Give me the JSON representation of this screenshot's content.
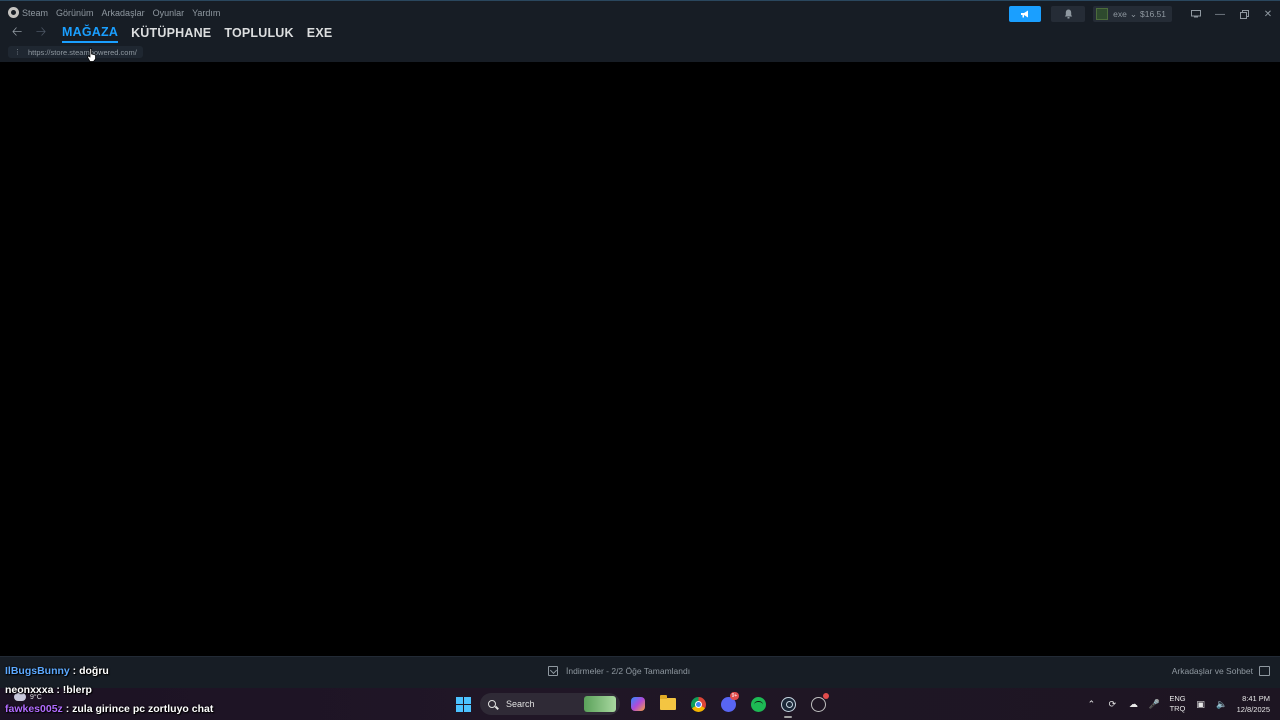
{
  "menu": {
    "steam": "Steam",
    "view": "Görünüm",
    "friends": "Arkadaşlar",
    "games": "Oyunlar",
    "help": "Yardım"
  },
  "tabs": [
    {
      "label": "MAĞAZA",
      "active": true
    },
    {
      "label": "KÜTÜPHANE",
      "active": false
    },
    {
      "label": "TOPLULUK",
      "active": false
    },
    {
      "label": "EXE",
      "active": false
    }
  ],
  "url": "https://store.steampowered.com/",
  "account": {
    "name": "exe",
    "balance": "$16.51"
  },
  "status": {
    "downloads": "İndirmeler - 2/2 Öğe Tamamlandı",
    "friends_chat": "Arkadaşlar ve Sohbet"
  },
  "taskbar": {
    "search_label": "Search",
    "discord_badge": "9+",
    "lang_top": "ENG",
    "lang_bottom": "TRQ",
    "time": "8:41 PM",
    "date": "12/8/2025",
    "weather_temp": "9°C"
  },
  "chat": [
    {
      "user": "IlBugsBunny",
      "message": ": doğru"
    },
    {
      "user": "neonxxxa",
      "message": ": !blerp"
    },
    {
      "user": "fawkes005z",
      "message": ": zula girince pc zortluyo chat"
    }
  ],
  "colors": {
    "accent": "#1a9fff",
    "titlebar": "#171d25",
    "content": "#000000"
  },
  "icons": [
    "steam-logo-icon",
    "back-arrow-icon",
    "forward-arrow-icon",
    "megaphone-icon",
    "bell-icon",
    "monitor-icon",
    "minimize-icon",
    "restore-icon",
    "close-icon",
    "download-icon",
    "friends-icon",
    "windows-start-icon",
    "search-icon",
    "copilot-icon",
    "folder-icon",
    "chrome-icon",
    "discord-icon",
    "spotify-icon",
    "steam-icon",
    "wifi-icon",
    "volume-icon"
  ]
}
